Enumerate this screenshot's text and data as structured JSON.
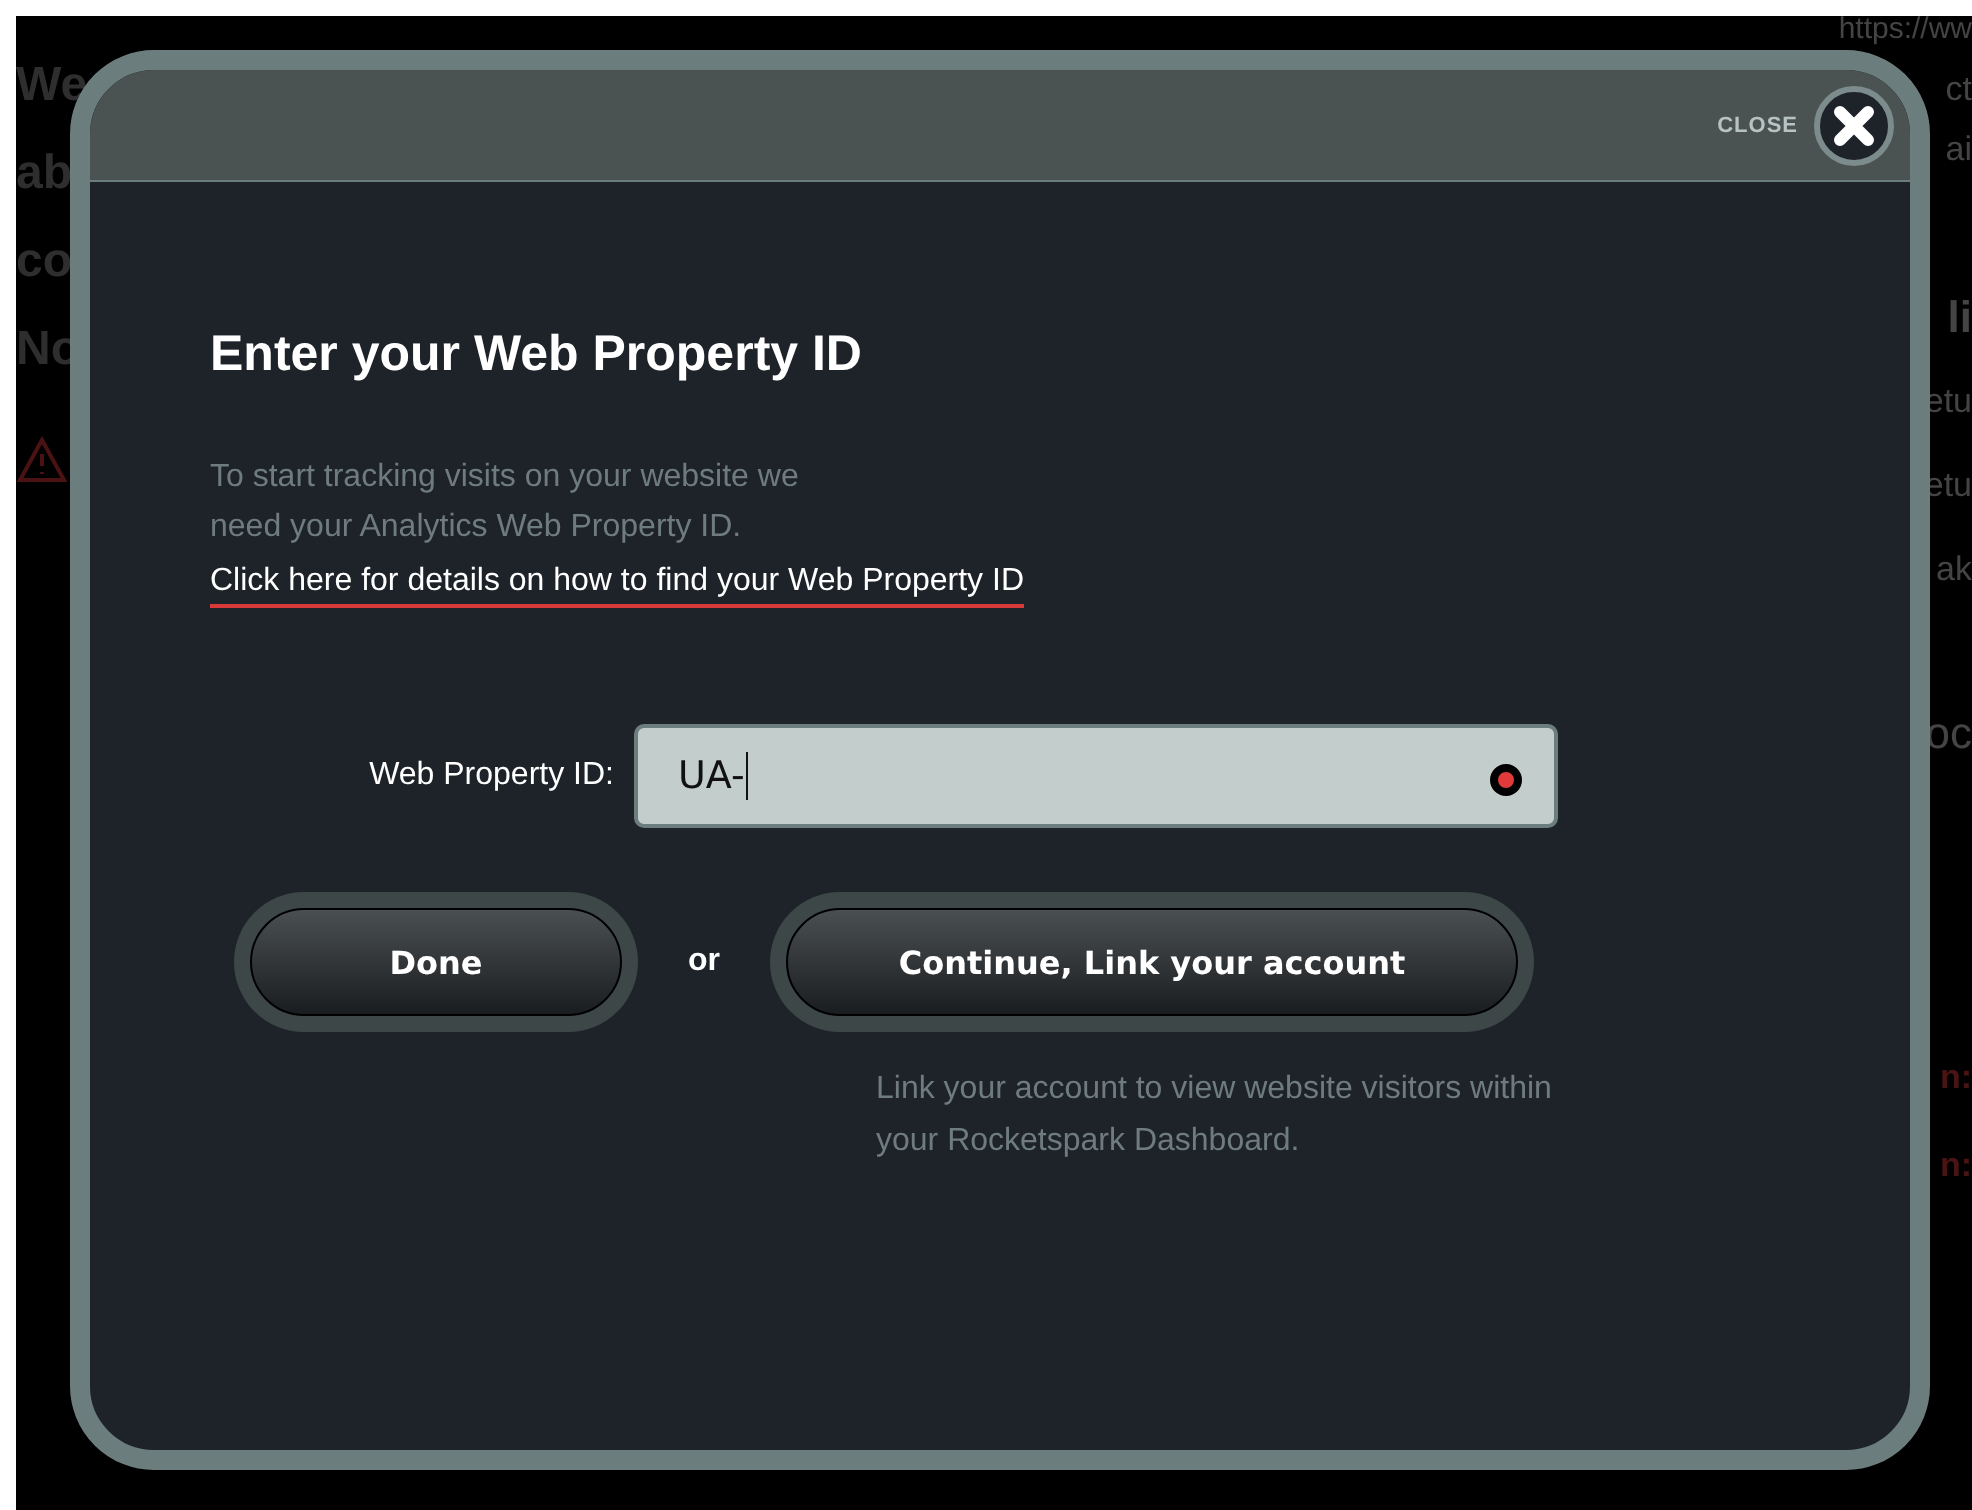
{
  "background": {
    "left_fragments": [
      "We",
      "ab",
      "co",
      "No"
    ],
    "right_fragments": [
      "https://ww",
      "ct",
      "ai",
      "li",
      "etu",
      "etu",
      "ak",
      "oc",
      "n:",
      "n:"
    ]
  },
  "dialog": {
    "close_label": "CLOSE",
    "title": "Enter your Web Property ID",
    "intro": [
      "To start tracking visits on your website we",
      "need your Analytics Web Property ID."
    ],
    "help_link": "Click here for details on how to find your Web Property ID",
    "field": {
      "label": "Web Property ID:",
      "value": "UA-",
      "error": true
    },
    "buttons": [
      {
        "label": "Done"
      },
      {
        "label": "Continue, Link your account"
      }
    ],
    "separator": "or",
    "note": [
      "Link your account to view website visitors within",
      "your Rocketspark Dashboard."
    ]
  }
}
